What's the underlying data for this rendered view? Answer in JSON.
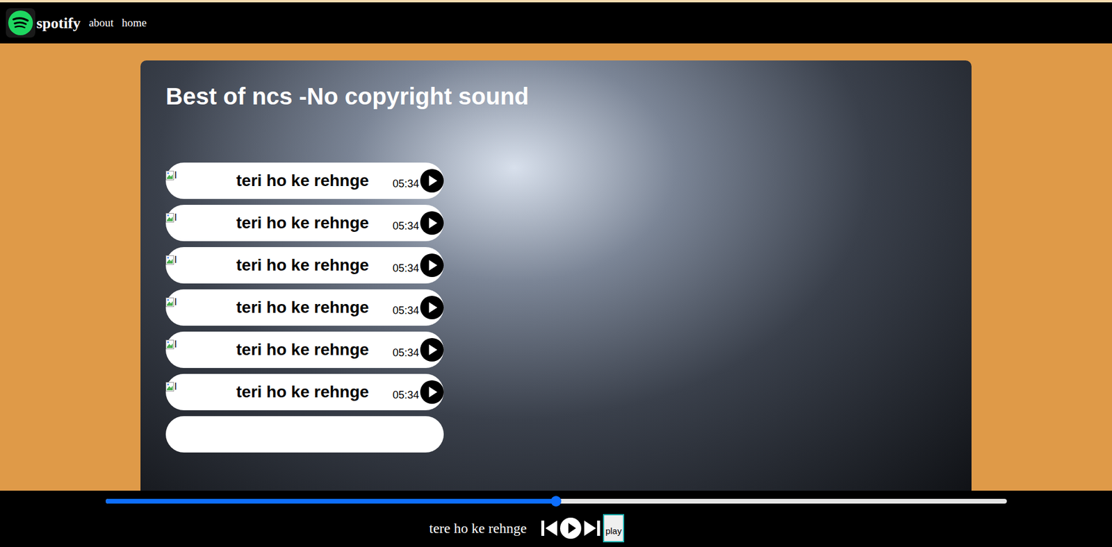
{
  "nav": {
    "brand": "spotify",
    "links": [
      "about",
      "home"
    ]
  },
  "playlist": {
    "title": "Best of ncs -No copyright sound",
    "songs": [
      {
        "cover_alt": "l",
        "title": "teri ho ke rehnge",
        "duration": "05:34"
      },
      {
        "cover_alt": "l",
        "title": "teri ho ke rehnge",
        "duration": "05:34"
      },
      {
        "cover_alt": "l",
        "title": "teri ho ke rehnge",
        "duration": "05:34"
      },
      {
        "cover_alt": "l",
        "title": "teri ho ke rehnge",
        "duration": "05:34"
      },
      {
        "cover_alt": "l",
        "title": "teri ho ke rehnge",
        "duration": "05:34"
      },
      {
        "cover_alt": "l",
        "title": "teri ho ke rehnge",
        "duration": "05:34"
      }
    ]
  },
  "player": {
    "now_playing": "tere ho ke rehnge",
    "level": 0.5,
    "button": "play"
  }
}
